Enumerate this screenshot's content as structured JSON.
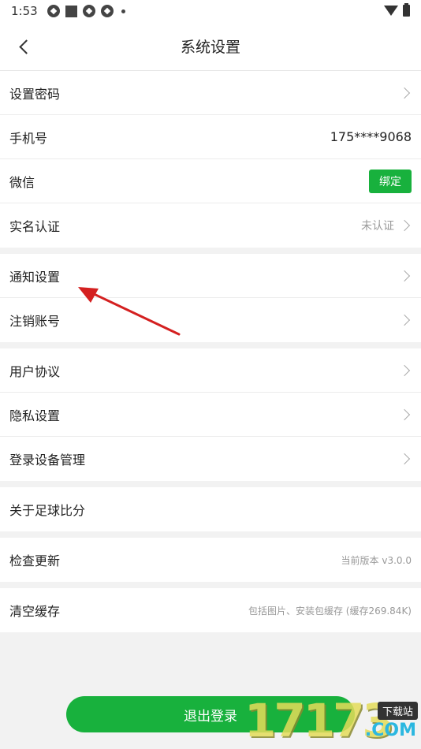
{
  "status_bar": {
    "time": "1:53"
  },
  "header": {
    "title": "系统设置"
  },
  "groups": [
    {
      "rows": [
        {
          "label": "设置密码"
        },
        {
          "label": "手机号",
          "value": "175****9068"
        },
        {
          "label": "微信",
          "button": "绑定"
        },
        {
          "label": "实名认证",
          "value": "未认证"
        }
      ]
    },
    {
      "rows": [
        {
          "label": "通知设置"
        },
        {
          "label": "注销账号"
        }
      ]
    },
    {
      "rows": [
        {
          "label": "用户协议"
        },
        {
          "label": "隐私设置"
        },
        {
          "label": "登录设备管理"
        }
      ]
    },
    {
      "rows": [
        {
          "label": "关于足球比分"
        }
      ]
    },
    {
      "rows": [
        {
          "label": "检查更新",
          "value": "当前版本 v3.0.0"
        }
      ]
    },
    {
      "rows": [
        {
          "label": "清空缓存",
          "value": "包括图片、安装包缓存 (缓存269.84K)"
        }
      ]
    }
  ],
  "logout": {
    "label": "退出登录"
  },
  "watermark": {
    "number": "17173",
    "tag": "下载站",
    "domain": ".COM"
  },
  "colors": {
    "accent": "#18b13d",
    "annotation_arrow": "#d42020"
  }
}
